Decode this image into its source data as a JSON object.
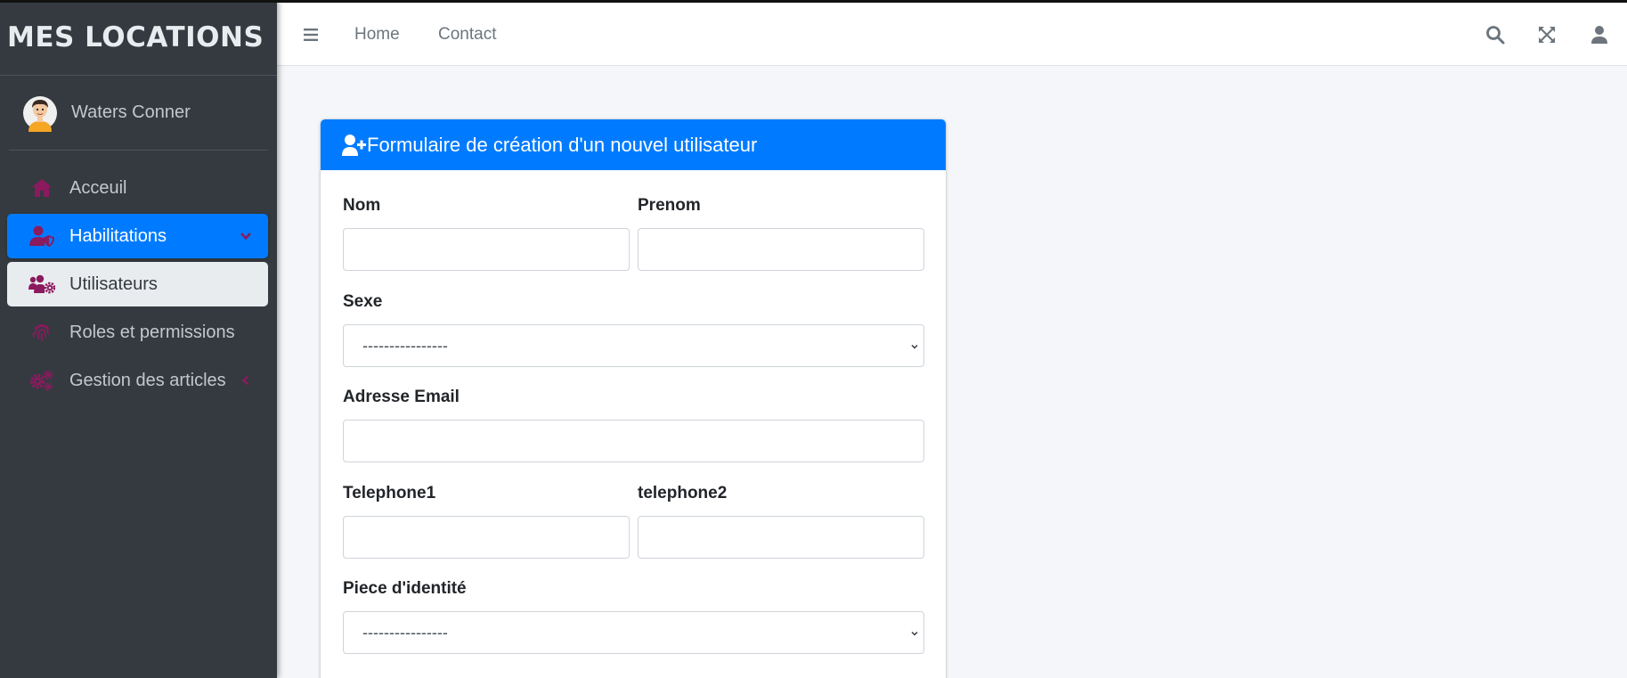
{
  "brand": "MES LOCATIONS",
  "user": {
    "name": "Waters Conner"
  },
  "sidebar": {
    "items": [
      {
        "label": "Acceuil",
        "icon": "home-icon"
      },
      {
        "label": "Habilitations",
        "icon": "user-shield-icon"
      },
      {
        "label": "Utilisateurs",
        "icon": "users-cog-icon"
      },
      {
        "label": "Roles et permissions",
        "icon": "fingerprint-icon"
      },
      {
        "label": "Gestion des articles",
        "icon": "cogs-icon"
      }
    ]
  },
  "navbar": {
    "links": [
      "Home",
      "Contact"
    ],
    "icons": [
      "search-icon",
      "expand-icon",
      "user-icon"
    ]
  },
  "form": {
    "title": "Formulaire de création d'un nouvel utilisateur",
    "nom_label": "Nom",
    "prenom_label": "Prenom",
    "sexe_label": "Sexe",
    "sexe_value": "----------------",
    "email_label": "Adresse Email",
    "tel1_label": "Telephone1",
    "tel2_label": "telephone2",
    "piece_label": "Piece d'identité",
    "piece_value": "----------------"
  },
  "colors": {
    "primary": "#007bff",
    "sidebar_bg": "#343a40",
    "icon_accent": "#8b1a5e",
    "content_bg": "#f4f6f9"
  }
}
